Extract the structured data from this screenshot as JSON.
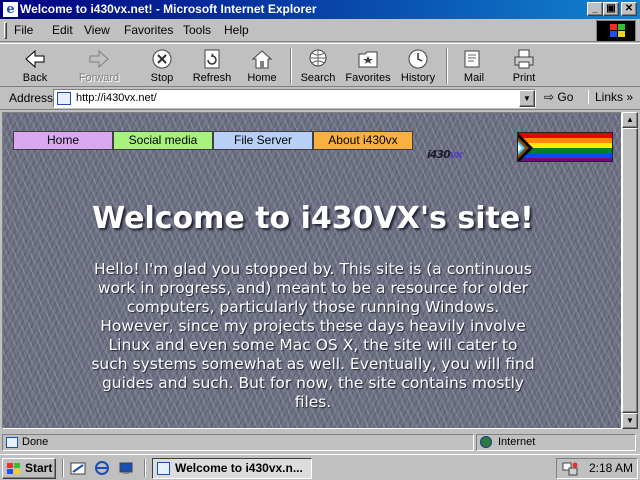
{
  "window": {
    "title": "Welcome to i430vx.net! - Microsoft Internet Explorer"
  },
  "menu": {
    "items": [
      "File",
      "Edit",
      "View",
      "Favorites",
      "Tools",
      "Help"
    ]
  },
  "toolbar": {
    "back": "Back",
    "forward": "Forward",
    "stop": "Stop",
    "refresh": "Refresh",
    "home": "Home",
    "search": "Search",
    "favorites": "Favorites",
    "history": "History",
    "mail": "Mail",
    "print": "Print"
  },
  "address": {
    "label": "Address",
    "url": "http://i430vx.net/",
    "go": "Go",
    "links": "Links"
  },
  "page": {
    "nav": [
      "Home",
      "Social media",
      "File Server",
      "About i430vx"
    ],
    "nav_colors": [
      "#d8a8f0",
      "#a8f080",
      "#b8d0f8",
      "#f8b040"
    ],
    "logo_a": "i430",
    "logo_b": "vx",
    "heading": "Welcome to i430VX's site!",
    "intro": "Hello! I'm glad you stopped by. This site is (a continuous work in progress, and) meant to be a resource for older computers, particularly those running Windows. However, since my projects these days heavily involve Linux and even some Mac OS X, the site will cater to such systems somewhat as well. Eventually, you will find guides and such. But for now, the site contains mostly files."
  },
  "status": {
    "text": "Done",
    "zone": "Internet"
  },
  "taskbar": {
    "start": "Start",
    "task": "Welcome to i430vx.n...",
    "time": "2:18 AM"
  }
}
